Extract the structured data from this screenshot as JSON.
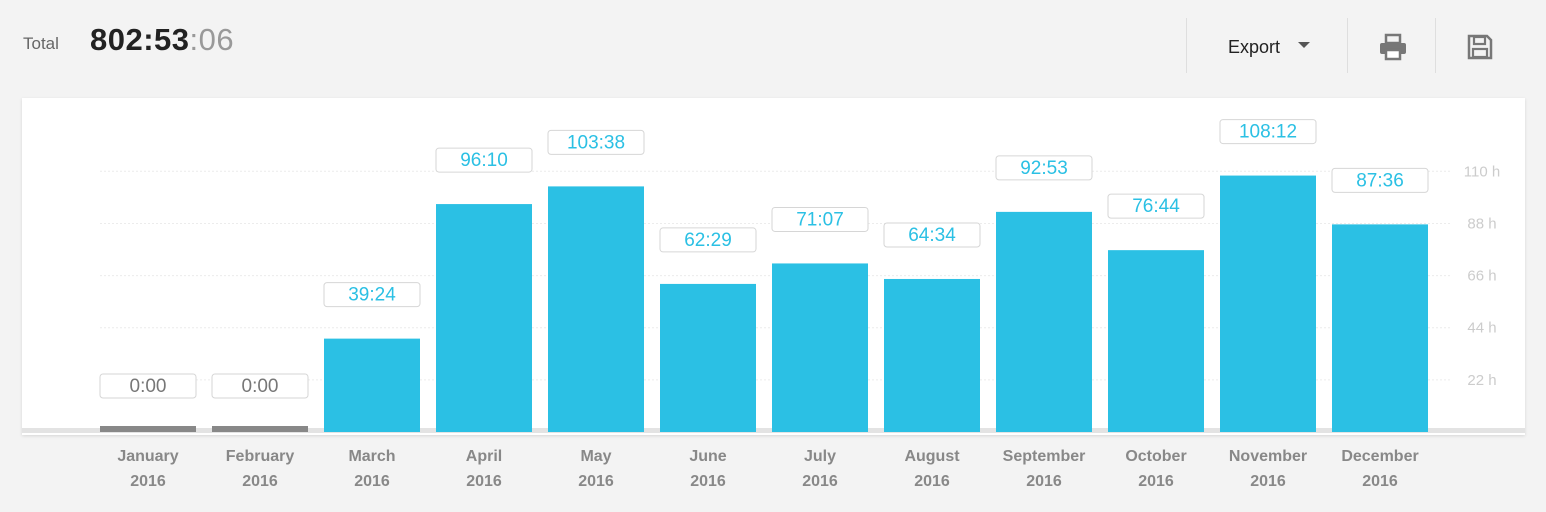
{
  "header": {
    "total_label": "Total",
    "total_main": "802:53",
    "total_secs": ":06"
  },
  "toolbar": {
    "export_label": "Export",
    "print_icon": "printer-icon",
    "save_icon": "floppy-disk-icon"
  },
  "colors": {
    "bar": "#2bc0e4",
    "bar_empty": "#888888",
    "label_text": "#2bc0e4",
    "zero_label_text": "#777777",
    "axis_text": "#cccccc",
    "baseline": "#e3e3e3"
  },
  "chart_data": {
    "type": "bar",
    "categories": [
      [
        "January",
        "2016"
      ],
      [
        "February",
        "2016"
      ],
      [
        "March",
        "2016"
      ],
      [
        "April",
        "2016"
      ],
      [
        "May",
        "2016"
      ],
      [
        "June",
        "2016"
      ],
      [
        "July",
        "2016"
      ],
      [
        "August",
        "2016"
      ],
      [
        "September",
        "2016"
      ],
      [
        "October",
        "2016"
      ],
      [
        "November",
        "2016"
      ],
      [
        "December",
        "2016"
      ]
    ],
    "values": [
      0,
      0,
      39.4,
      96.17,
      103.63,
      62.48,
      71.12,
      64.57,
      92.88,
      76.73,
      108.2,
      87.6
    ],
    "data_labels": [
      "0:00",
      "0:00",
      "39:24",
      "96:10",
      "103:38",
      "62:29",
      "71:07",
      "64:34",
      "92:53",
      "76:44",
      "108:12",
      "87:36"
    ],
    "y_ticks": [
      22,
      44,
      66,
      88,
      110
    ],
    "y_tick_labels": [
      "22 h",
      "44 h",
      "66 h",
      "88 h",
      "110 h"
    ],
    "ylim": [
      0,
      110
    ],
    "y_axis_position": "right",
    "grid": true
  }
}
